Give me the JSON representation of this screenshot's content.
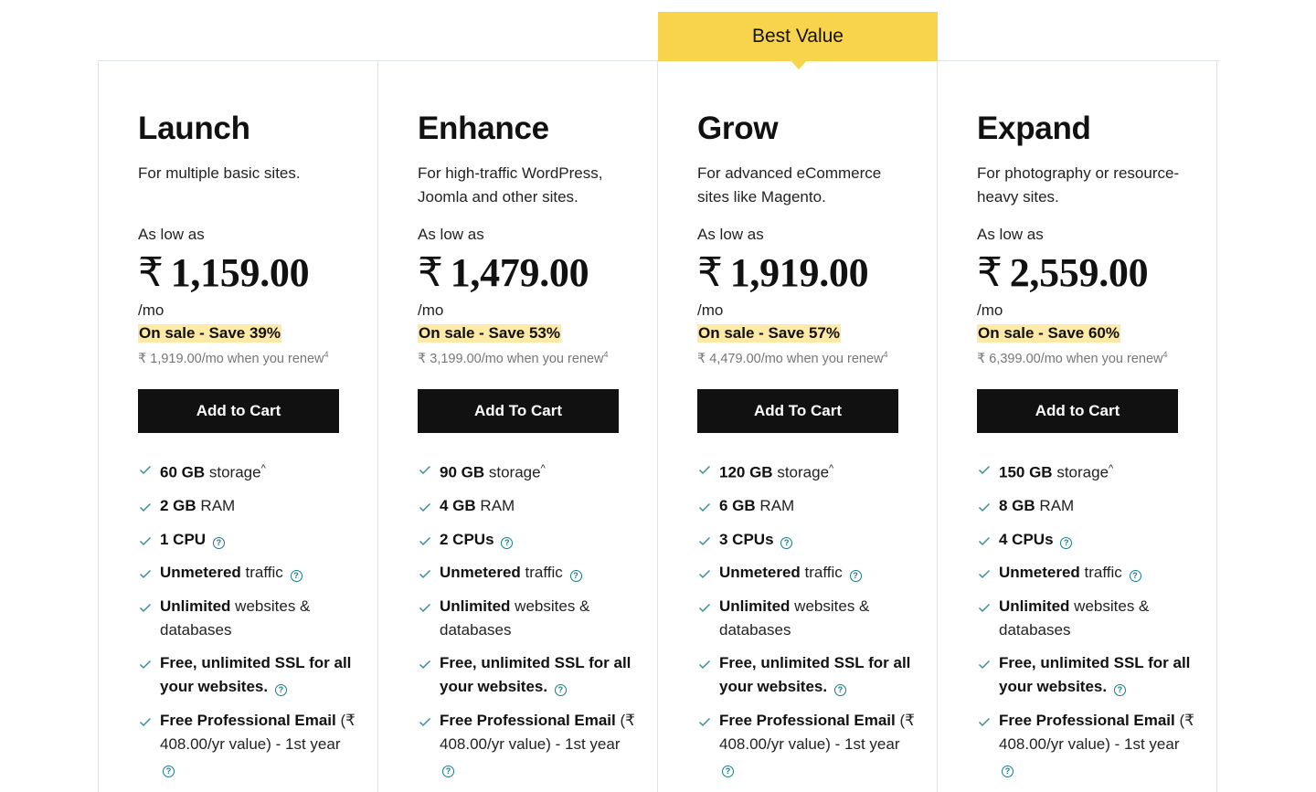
{
  "badge": {
    "label": "Best Value",
    "color": "#f7d44b",
    "plan_index": 2
  },
  "common": {
    "as_low_as": "As low as",
    "per_month": "/mo",
    "currency": "₹",
    "renew_suffix": "/mo when you renew",
    "renew_footnote": "4",
    "storage_footnote": "^",
    "help_glyph": "?"
  },
  "plans": [
    {
      "name": "Launch",
      "description": "For multiple basic sites.",
      "price": "1,159.00",
      "sale": "On sale - Save 39%",
      "renew_price": "₹ 1,919.00",
      "cta": "Add to Cart",
      "features": {
        "storage": {
          "bold": "60 GB",
          "text": " storage"
        },
        "ram": {
          "bold": "2 GB",
          "text": " RAM"
        },
        "cpu": {
          "bold": "1 CPU",
          "text": ""
        },
        "traffic": {
          "bold": "Unmetered",
          "text": " traffic"
        },
        "sites": {
          "bold": "Unlimited",
          "text": " websites & databases"
        },
        "ssl": {
          "bold": "Free, unlimited SSL for all your websites.",
          "text": ""
        },
        "email": {
          "bold": "Free Professional Email",
          "text": " (₹ 408.00/yr value) - 1st year"
        }
      }
    },
    {
      "name": "Enhance",
      "description": "For high-traffic WordPress, Joomla and other sites.",
      "price": "1,479.00",
      "sale": "On sale - Save 53%",
      "renew_price": "₹ 3,199.00",
      "cta": "Add To Cart",
      "features": {
        "storage": {
          "bold": "90 GB",
          "text": " storage"
        },
        "ram": {
          "bold": "4 GB",
          "text": " RAM"
        },
        "cpu": {
          "bold": "2 CPUs",
          "text": ""
        },
        "traffic": {
          "bold": "Unmetered",
          "text": " traffic"
        },
        "sites": {
          "bold": "Unlimited",
          "text": " websites & databases"
        },
        "ssl": {
          "bold": "Free, unlimited SSL for all your websites.",
          "text": ""
        },
        "email": {
          "bold": "Free Professional Email",
          "text": " (₹ 408.00/yr value) - 1st year"
        }
      }
    },
    {
      "name": "Grow",
      "description": "For advanced eCommerce sites like Magento.",
      "price": "1,919.00",
      "sale": "On sale - Save 57%",
      "renew_price": "₹ 4,479.00",
      "cta": "Add To Cart",
      "features": {
        "storage": {
          "bold": "120 GB",
          "text": " storage"
        },
        "ram": {
          "bold": "6 GB",
          "text": " RAM"
        },
        "cpu": {
          "bold": "3 CPUs",
          "text": ""
        },
        "traffic": {
          "bold": "Unmetered",
          "text": " traffic"
        },
        "sites": {
          "bold": "Unlimited",
          "text": " websites & databases"
        },
        "ssl": {
          "bold": "Free, unlimited SSL for all your websites.",
          "text": ""
        },
        "email": {
          "bold": "Free Professional Email",
          "text": " (₹ 408.00/yr value) - 1st year"
        }
      }
    },
    {
      "name": "Expand",
      "description": "For photography or resource-heavy sites.",
      "price": "2,559.00",
      "sale": "On sale - Save 60%",
      "renew_price": "₹ 6,399.00",
      "cta": "Add to Cart",
      "features": {
        "storage": {
          "bold": "150 GB",
          "text": " storage"
        },
        "ram": {
          "bold": "8 GB",
          "text": " RAM"
        },
        "cpu": {
          "bold": "4 CPUs",
          "text": ""
        },
        "traffic": {
          "bold": "Unmetered",
          "text": " traffic"
        },
        "sites": {
          "bold": "Unlimited",
          "text": " websites & databases"
        },
        "ssl": {
          "bold": "Free, unlimited SSL for all your websites.",
          "text": ""
        },
        "email": {
          "bold": "Free Professional Email",
          "text": " (₹ 408.00/yr value) - 1st year"
        }
      }
    }
  ]
}
